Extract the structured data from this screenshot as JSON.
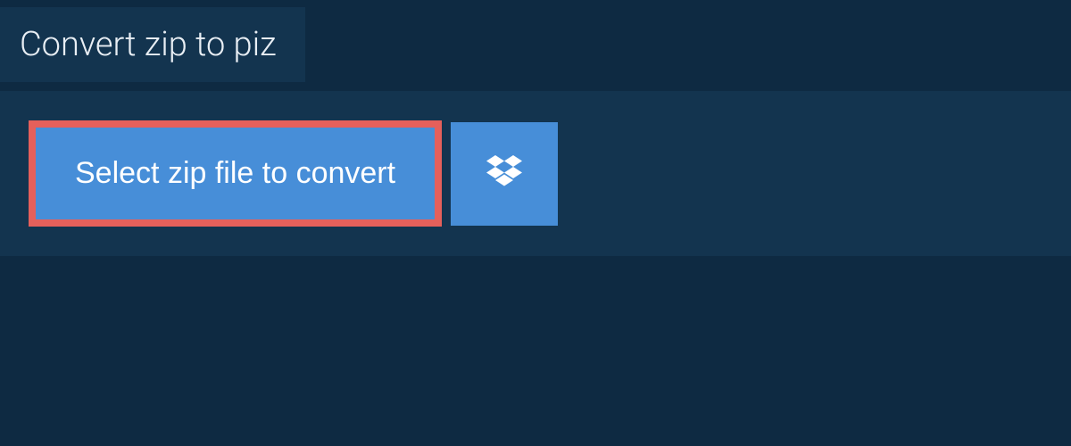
{
  "tab": {
    "title": "Convert zip to piz"
  },
  "buttons": {
    "select_file_label": "Select zip file to convert"
  },
  "icons": {
    "dropbox": "dropbox-icon"
  },
  "colors": {
    "bg_dark": "#0e2a42",
    "panel": "#13344f",
    "button": "#478ed8",
    "highlight": "#e5605b",
    "text_light": "#e8eef4"
  }
}
